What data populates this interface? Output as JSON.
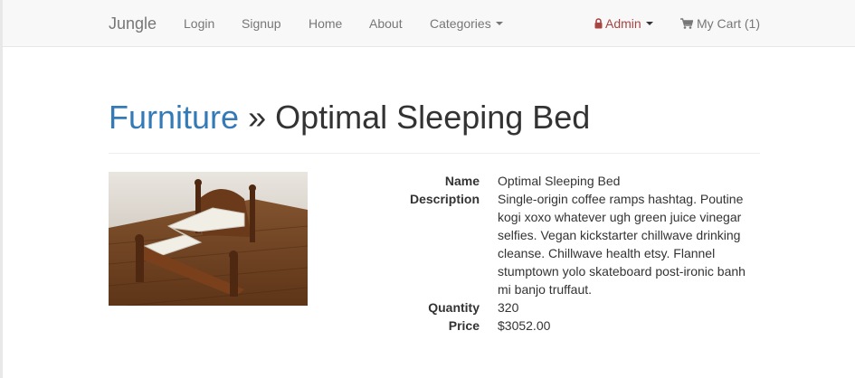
{
  "navbar": {
    "brand": "Jungle",
    "links": {
      "login": "Login",
      "signup": "Signup",
      "home": "Home",
      "about": "About",
      "categories": "Categories"
    },
    "admin_label": "Admin",
    "cart_label": "My Cart (1)",
    "icons": {
      "admin": "lock-icon",
      "cart": "shopping-cart-icon",
      "dropdown": "caret-down-icon"
    }
  },
  "header": {
    "category": "Furniture",
    "separator": "»",
    "product_name": "Optimal Sleeping Bed"
  },
  "product": {
    "image_alt": "wooden bed frame with zig-zag mattress on hardwood floor",
    "details": {
      "name_label": "Name",
      "name_value": "Optimal Sleeping Bed",
      "description_label": "Description",
      "description_value": "Single-origin coffee ramps hashtag. Poutine kogi xoxo whatever ugh green juice vinegar selfies. Vegan kickstarter chillwave drinking cleanse. Chillwave health etsy. Flannel stumptown yolo skateboard post-ironic banh mi banjo truffaut.",
      "quantity_label": "Quantity",
      "quantity_value": "320",
      "price_label": "Price",
      "price_value": "$3052.00"
    }
  },
  "colors": {
    "link_blue": "#337ab7",
    "admin_red": "#a94442",
    "navbar_bg": "#f8f8f8",
    "text": "#333333",
    "nav_text": "#777777"
  }
}
